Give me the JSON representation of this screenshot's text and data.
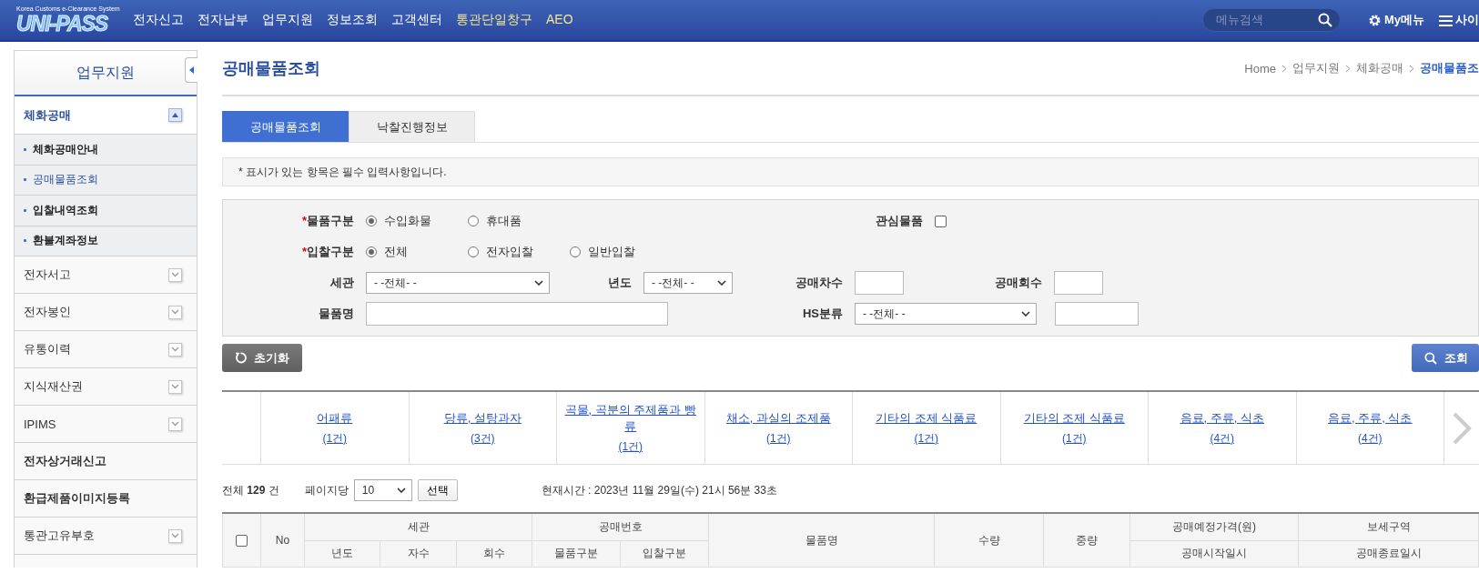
{
  "header": {
    "logo": {
      "tagline": "Korea Customs e-Clearance System",
      "name": "UNI-PASS"
    },
    "menu": [
      {
        "label": "전자신고",
        "highlight": false
      },
      {
        "label": "전자납부",
        "highlight": false
      },
      {
        "label": "업무지원",
        "highlight": false
      },
      {
        "label": "정보조회",
        "highlight": false
      },
      {
        "label": "고객센터",
        "highlight": false
      },
      {
        "label": "통관단일창구",
        "highlight": true
      },
      {
        "label": "AEO",
        "highlight": true
      }
    ],
    "search": {
      "placeholder": "메뉴검색"
    },
    "links": [
      {
        "kind": "gear",
        "label": "My메뉴"
      },
      {
        "kind": "menu",
        "label": "사이"
      }
    ]
  },
  "sidebar": {
    "title": "업무지원",
    "items": [
      {
        "kind": "group",
        "label": "체화공매",
        "expanded": true,
        "children": [
          {
            "label": "체화공매안내",
            "selected": false
          },
          {
            "label": "공매물품조회",
            "selected": true
          },
          {
            "label": "입찰내역조회",
            "selected": false
          },
          {
            "label": "환불계좌정보",
            "selected": false
          }
        ]
      },
      {
        "kind": "group",
        "label": "전자서고",
        "expanded": false
      },
      {
        "kind": "group",
        "label": "전자봉인",
        "expanded": false
      },
      {
        "kind": "group",
        "label": "유통이력",
        "expanded": false
      },
      {
        "kind": "group",
        "label": "지식재산권",
        "expanded": false
      },
      {
        "kind": "group",
        "label": "IPIMS",
        "expanded": false
      },
      {
        "kind": "link",
        "label": "전자상거래신고"
      },
      {
        "kind": "link",
        "label": "환급제품이미지등록"
      },
      {
        "kind": "group",
        "label": "통관고유부호",
        "expanded": false
      }
    ]
  },
  "page": {
    "title": "공매물품조회",
    "breadcrumb": [
      {
        "label": "Home",
        "current": false
      },
      {
        "label": "업무지원",
        "current": false
      },
      {
        "label": "체화공매",
        "current": false
      },
      {
        "label": "공매물품조",
        "current": true
      }
    ]
  },
  "tabs": [
    {
      "label": "공매물품조회",
      "selected": true
    },
    {
      "label": "낙찰진행정보",
      "selected": false
    }
  ],
  "notice": "* 표시가 있는 항목은 필수 입력사항입니다.",
  "form": {
    "item_type": {
      "mark": "*",
      "label": "물품구분",
      "options": [
        {
          "label": "수입화물",
          "selected": true
        },
        {
          "label": "휴대품",
          "selected": false
        }
      ]
    },
    "interest": {
      "label": "관심물품",
      "checked": false
    },
    "bid_type": {
      "mark": "*",
      "label": "입찰구분",
      "options": [
        {
          "label": "전체",
          "selected": true
        },
        {
          "label": "전자입찰",
          "selected": false
        },
        {
          "label": "일반입찰",
          "selected": false
        }
      ]
    },
    "customs": {
      "label": "세관",
      "value": "- -전체- -"
    },
    "year": {
      "label": "년도",
      "value": "- -전체- -"
    },
    "sale_round": {
      "label": "공매차수"
    },
    "sale_count": {
      "label": "공매회수"
    },
    "item_name": {
      "label": "물품명"
    },
    "hs": {
      "label": "HS분류",
      "value": "- -전체- -"
    }
  },
  "buttons": {
    "reset": "초기화",
    "search": "조회"
  },
  "categories": [
    {
      "name": "어패류",
      "count": "(1건)"
    },
    {
      "name": "당류, 설탕과자",
      "count": "(3건)"
    },
    {
      "name": "곡물, 곡분의 주제품과 빵류",
      "count": "(1건)"
    },
    {
      "name": "채소, 과실의 조제품",
      "count": "(1건)"
    },
    {
      "name": "기타의 조제 식품료",
      "count": "(1건)"
    },
    {
      "name": "기타의 조제 식품료",
      "count": "(1건)"
    },
    {
      "name": "음료, 주류, 식초",
      "count": "(4건)"
    },
    {
      "name": "음료, 주류, 식초",
      "count": "(4건)"
    }
  ],
  "summary": {
    "total": "전체 **129** 건",
    "per_page_label": "페이지당",
    "per_page": "10",
    "apply": "선택",
    "time": "현재시간 : 2023년 11월 29일(수) 21시 56분 33초"
  },
  "table": {
    "select_all": {
      "checked": false
    },
    "columns": [
      {
        "kind": "single",
        "label": "No"
      },
      {
        "kind": "group",
        "label": "세관",
        "children": [
          "년도",
          "자수",
          "회수"
        ]
      },
      {
        "kind": "group",
        "label": "공매번호",
        "children": [
          "물품구분",
          "입찰구분"
        ]
      },
      {
        "kind": "single",
        "label": "물품명"
      },
      {
        "kind": "single",
        "label": "수량"
      },
      {
        "kind": "single",
        "label": "중량"
      },
      {
        "kind": "stacked",
        "label": "공매예정가격(원)",
        "sub": "공매시작일시"
      },
      {
        "kind": "stacked",
        "label": "보세구역",
        "sub": "공매종료일시"
      }
    ]
  }
}
